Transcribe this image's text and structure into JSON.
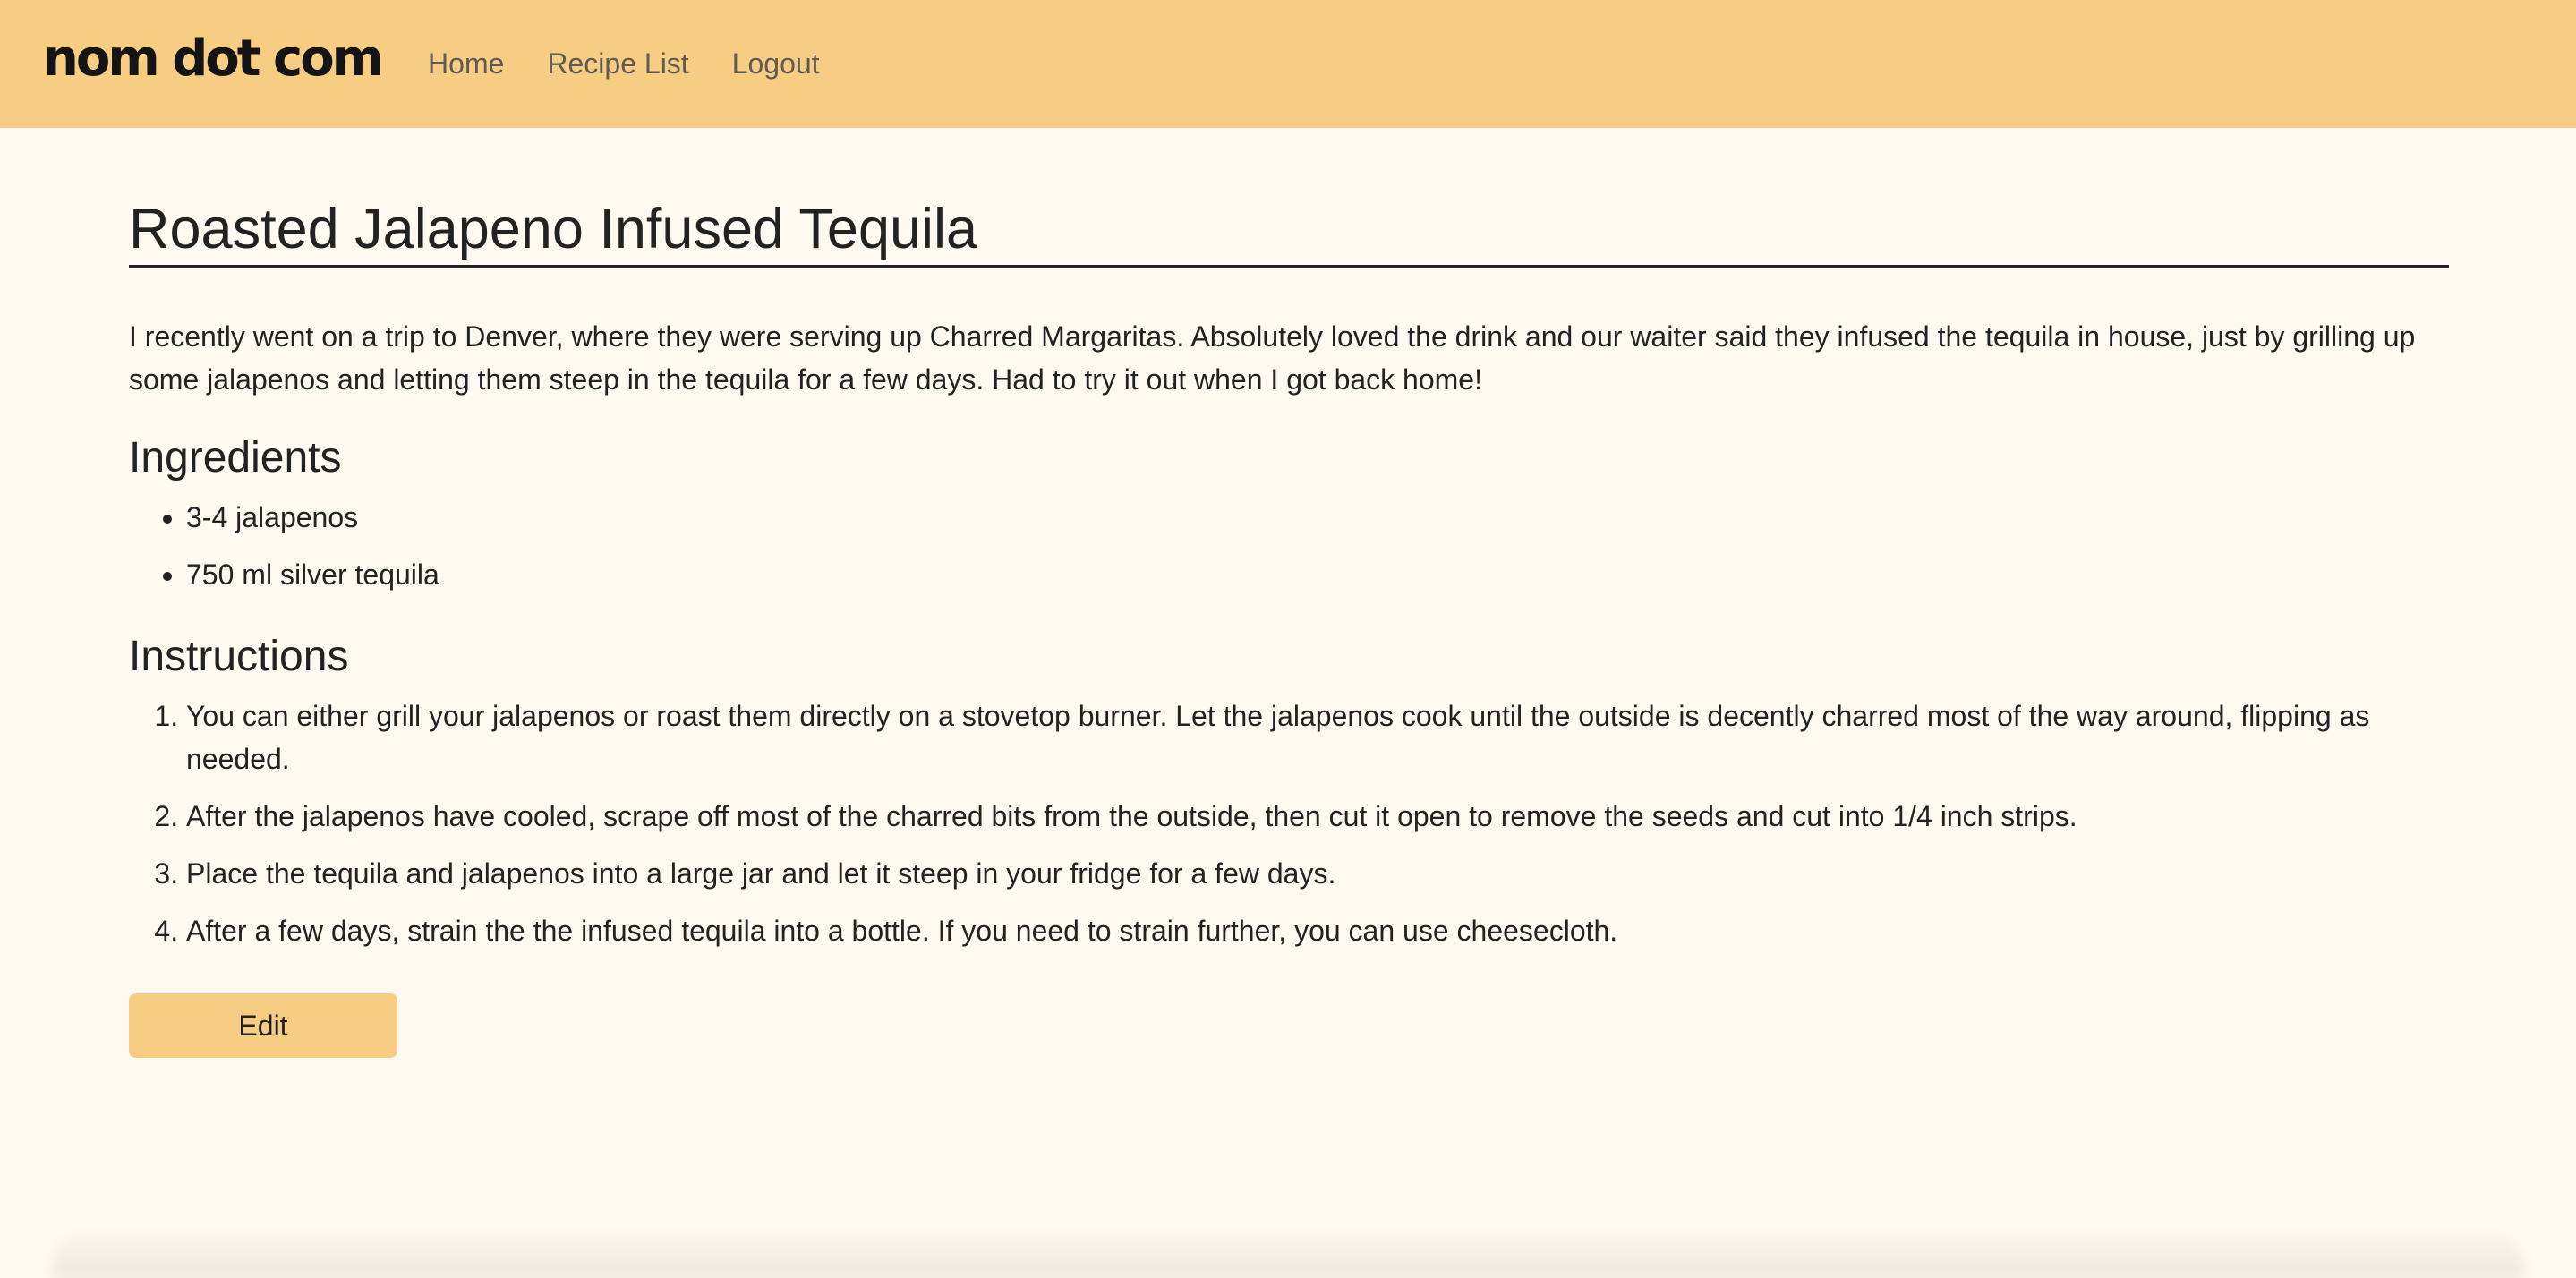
{
  "header": {
    "brand": "nom dot com",
    "nav": [
      {
        "label": "Home"
      },
      {
        "label": "Recipe List"
      },
      {
        "label": "Logout"
      }
    ]
  },
  "recipe": {
    "title": "Roasted Jalapeno Infused Tequila",
    "description": "I recently went on a trip to Denver, where they were serving up Charred Margaritas. Absolutely loved the drink and our waiter said they infused the tequila in house, just by grilling up some jalapenos and letting them steep in the tequila for a few days. Had to try it out when I got back home!",
    "ingredients_heading": "Ingredients",
    "ingredients": [
      "3-4 jalapenos",
      "750 ml silver tequila"
    ],
    "instructions_heading": "Instructions",
    "instructions": [
      "You can either grill your jalapenos or roast them directly on a stovetop burner. Let the jalapenos cook until the outside is decently charred most of the way around, flipping as needed.",
      "After the jalapenos have cooled, scrape off most of the charred bits from the outside, then cut it open to remove the seeds and cut into 1/4 inch strips.",
      "Place the tequila and jalapenos into a large jar and let it steep in your fridge for a few days.",
      "After a few days, strain the the infused tequila into a bottle. If you need to strain further, you can use cheesecloth."
    ],
    "edit_label": "Edit"
  },
  "colors": {
    "accent": "#f7cd84",
    "background": "#fdf8f0",
    "text": "#222222",
    "nav_text": "#5f5a52"
  }
}
